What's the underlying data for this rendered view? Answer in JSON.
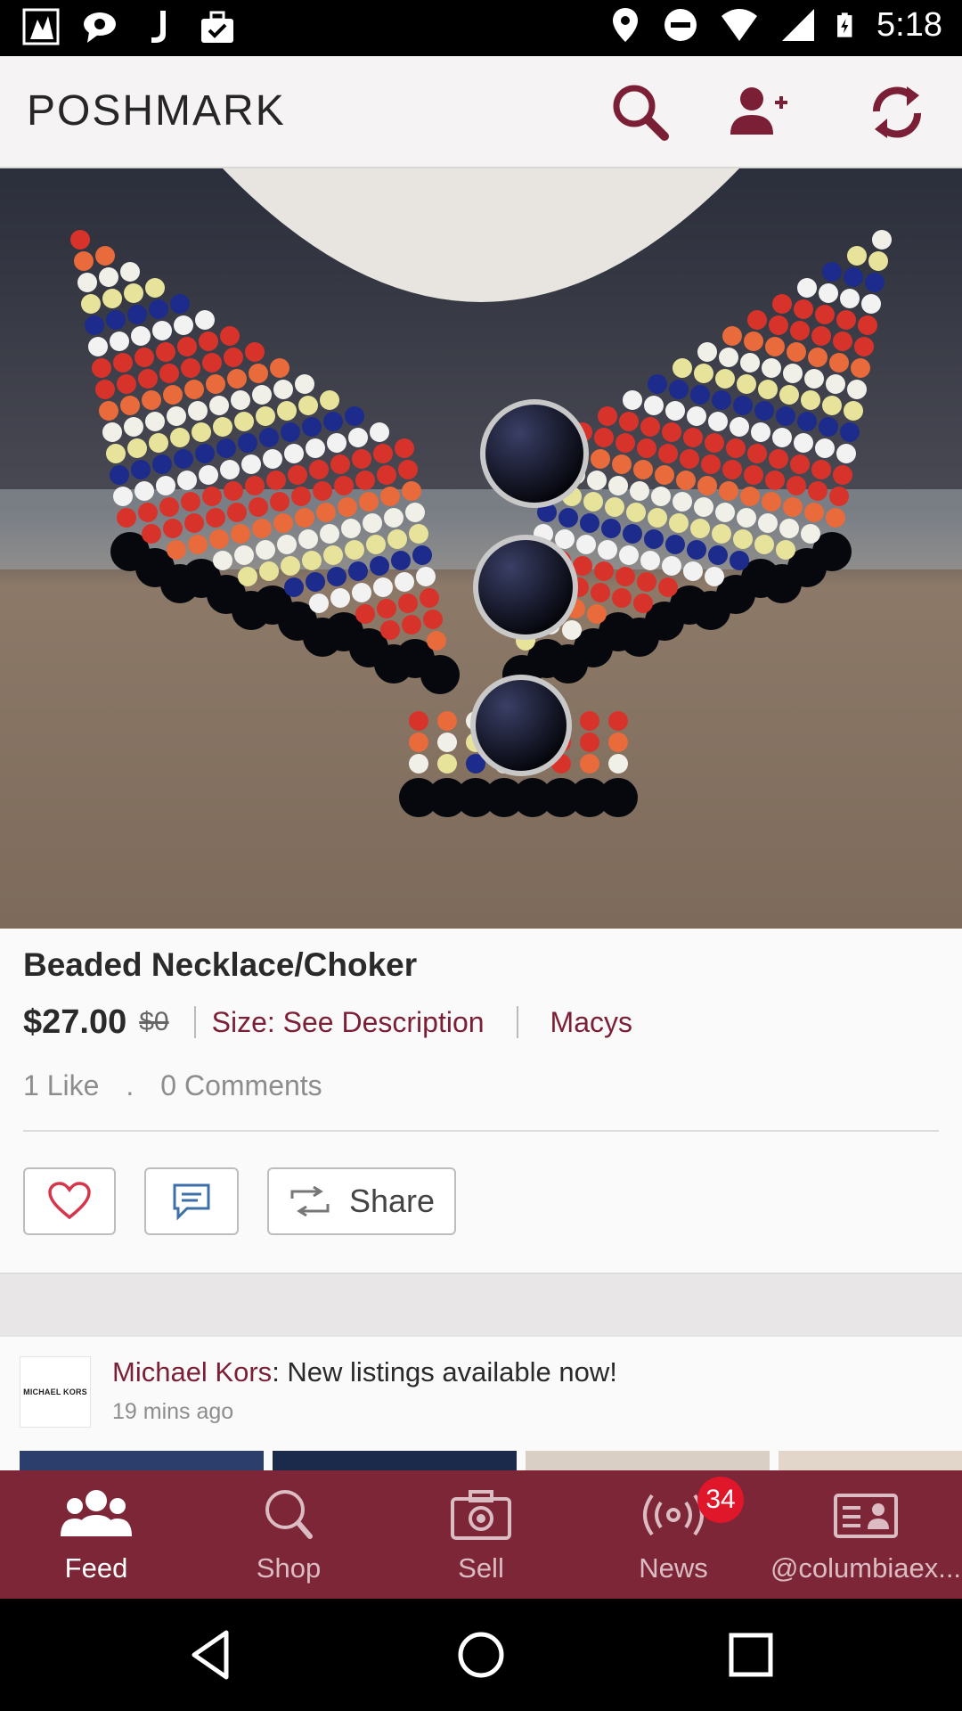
{
  "status_bar": {
    "time": "5:18"
  },
  "app_bar": {
    "brand": "POSHMARK"
  },
  "listing": {
    "title": "Beaded Necklace/Choker",
    "price": "$27.00",
    "original_price": "$0",
    "size": "Size: See Description",
    "brand": "Macys",
    "likes": "1 Like",
    "dot": ".",
    "comments": "0 Comments",
    "share_label": "Share"
  },
  "feed_item": {
    "avatar_text": "MICHAEL KORS",
    "author": "Michael Kors",
    "message": ": New listings available now!",
    "time_ago": "19 mins ago"
  },
  "bottom_nav": {
    "items": [
      {
        "label": "Feed",
        "icon": "people-icon",
        "active": true
      },
      {
        "label": "Shop",
        "icon": "search-icon",
        "active": false
      },
      {
        "label": "Sell",
        "icon": "camera-icon",
        "active": false
      },
      {
        "label": "News",
        "icon": "broadcast-icon",
        "active": false
      },
      {
        "label": "@columbiaex...",
        "icon": "profile-card-icon",
        "active": false
      }
    ],
    "news_badge": "34"
  },
  "colors": {
    "brand_maroon": "#7d2637",
    "link_maroon": "#7b1f36",
    "badge_red": "#e0162b"
  }
}
